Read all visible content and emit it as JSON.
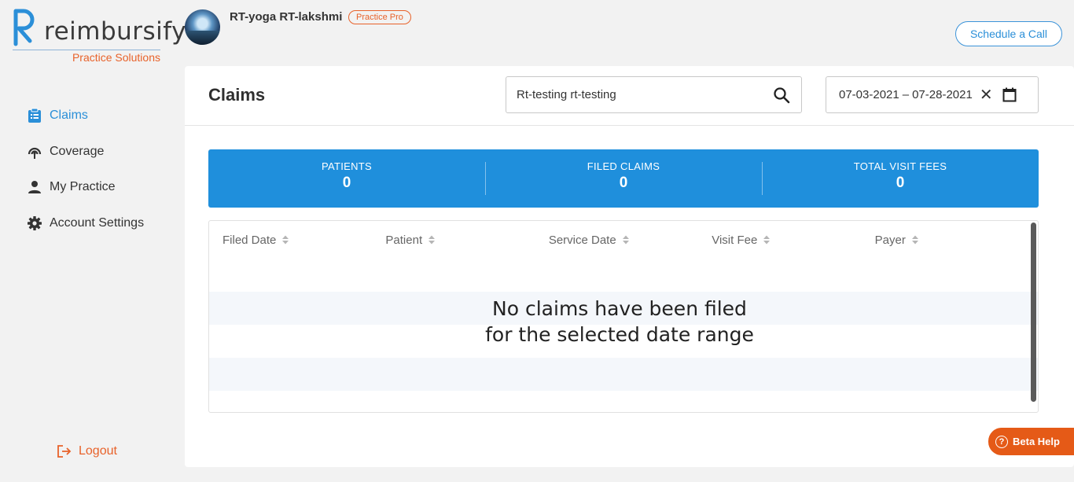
{
  "brand": {
    "name": "reimbursify",
    "subtitle": "Practice Solutions",
    "accent": "#2b8fd8",
    "orange": "#e8622a"
  },
  "sidebar": {
    "items": [
      {
        "label": "Claims",
        "icon": "clipboard-icon",
        "active": true
      },
      {
        "label": "Coverage",
        "icon": "coverage-icon",
        "active": false
      },
      {
        "label": "My Practice",
        "icon": "person-icon",
        "active": false
      },
      {
        "label": "Account Settings",
        "icon": "gear-icon",
        "active": false
      }
    ],
    "logout": "Logout"
  },
  "header": {
    "user_name": "RT-yoga RT-lakshmi",
    "plan_badge": "Practice Pro",
    "schedule_button": "Schedule a Call"
  },
  "main": {
    "title": "Claims",
    "search": {
      "value": "Rt-testing rt-testing"
    },
    "date_range": {
      "start": "07-03-2021",
      "separator": "–",
      "end": "07-28-2021"
    },
    "stats": [
      {
        "label": "PATIENTS",
        "value": "0"
      },
      {
        "label": "FILED CLAIMS",
        "value": "0"
      },
      {
        "label": "TOTAL VISIT FEES",
        "value": "0"
      }
    ],
    "table": {
      "columns": [
        "Filed Date",
        "Patient",
        "Service Date",
        "Visit Fee",
        "Payer"
      ],
      "empty_line1": "No claims have been filed",
      "empty_line2": "for the selected date range"
    }
  },
  "beta_help": "Beta Help"
}
